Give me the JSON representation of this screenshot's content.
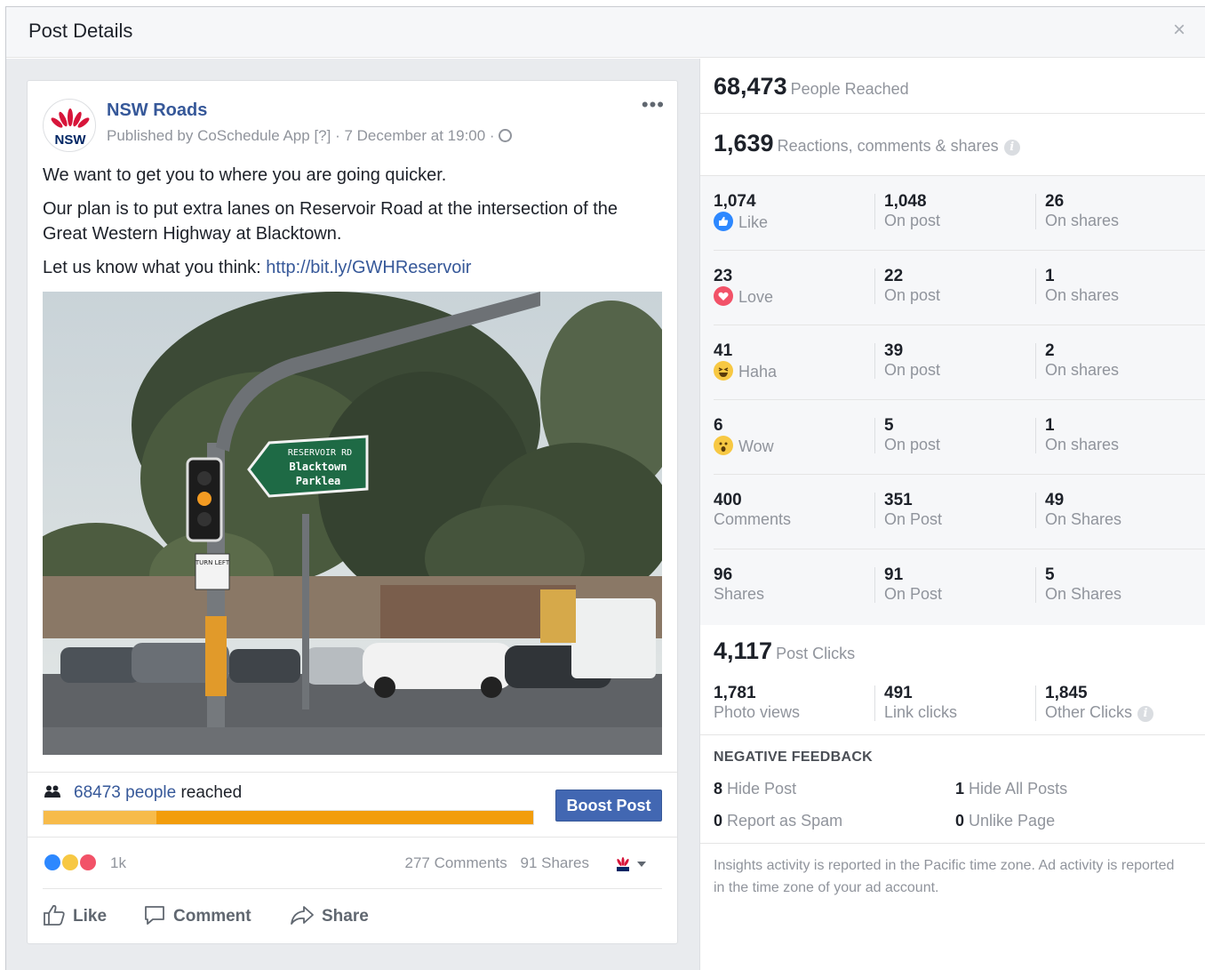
{
  "modal": {
    "title": "Post Details",
    "close_glyph": "×"
  },
  "post": {
    "page_name": "NSW Roads",
    "avatar_text": "NSW",
    "meta": "Published by CoSchedule App [?] · 7 December at 19:00 ·",
    "more_glyph": "•••",
    "paragraphs": [
      "We want to get you to where you are going quicker.",
      "Our plan is to put extra lanes on Reservoir Road at the intersection of the Great Western Highway at Blacktown.",
      "Let us know what you think:"
    ],
    "link": "http://bit.ly/GWHReservoir",
    "photo_sign": {
      "line1": "RESERVOIR RD",
      "line2": "Blacktown",
      "line3": "Parklea",
      "turn_sign": "TURN LEFT"
    },
    "reach": {
      "count": "68473",
      "people_word": "people",
      "reached_word": "reached",
      "organic_fraction": 0.23
    },
    "boost_label": "Boost Post",
    "reactions_count": "1k",
    "comments_label": "277 Comments",
    "shares_label": "91 Shares",
    "actions": {
      "like": "Like",
      "comment": "Comment",
      "share": "Share"
    }
  },
  "insights": {
    "reached": {
      "value": "68,473",
      "label": "People Reached"
    },
    "engagement": {
      "value": "1,639",
      "label": "Reactions, comments & shares"
    },
    "rows": [
      {
        "total": "1,074",
        "name": "Like",
        "on_post": "1,048",
        "on_post_label": "On post",
        "on_shares": "26",
        "on_shares_label": "On shares",
        "icon": "like-icon"
      },
      {
        "total": "23",
        "name": "Love",
        "on_post": "22",
        "on_post_label": "On post",
        "on_shares": "1",
        "on_shares_label": "On shares",
        "icon": "love-icon"
      },
      {
        "total": "41",
        "name": "Haha",
        "on_post": "39",
        "on_post_label": "On post",
        "on_shares": "2",
        "on_shares_label": "On shares",
        "icon": "haha-icon"
      },
      {
        "total": "6",
        "name": "Wow",
        "on_post": "5",
        "on_post_label": "On post",
        "on_shares": "1",
        "on_shares_label": "On shares",
        "icon": "wow-icon"
      },
      {
        "total": "400",
        "name": "Comments",
        "on_post": "351",
        "on_post_label": "On Post",
        "on_shares": "49",
        "on_shares_label": "On Shares"
      },
      {
        "total": "96",
        "name": "Shares",
        "on_post": "91",
        "on_post_label": "On Post",
        "on_shares": "5",
        "on_shares_label": "On Shares"
      }
    ],
    "clicks": {
      "value": "4,117",
      "label": "Post Clicks",
      "photo_views": "1,781",
      "photo_views_label": "Photo views",
      "link_clicks": "491",
      "link_clicks_label": "Link clicks",
      "other_clicks": "1,845",
      "other_clicks_label": "Other Clicks"
    },
    "negative": {
      "title": "NEGATIVE FEEDBACK",
      "hide_post": "8",
      "hide_post_label": "Hide Post",
      "hide_all": "1",
      "hide_all_label": "Hide All Posts",
      "spam": "0",
      "spam_label": "Report as Spam",
      "unlike": "0",
      "unlike_label": "Unlike Page"
    },
    "note": "Insights activity is reported in the Pacific time zone. Ad activity is reported in the time zone of your ad account."
  },
  "colors": {
    "link": "#365899",
    "boost": "#4267b2",
    "reach_paid": "#f29d0c",
    "reach_organic": "#f7bb4a",
    "muted": "#90949c"
  }
}
